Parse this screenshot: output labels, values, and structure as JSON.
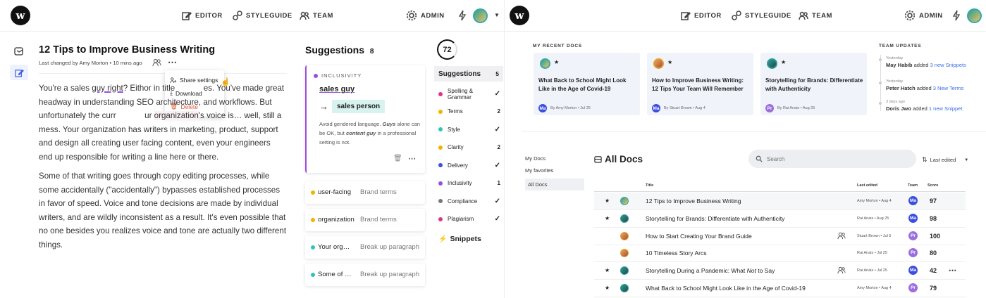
{
  "brand": {
    "logo_letter": "w"
  },
  "nav": {
    "editor": "EDITOR",
    "styleguide": "STYLEGUIDE",
    "team": "TEAM",
    "admin": "ADMIN"
  },
  "editor": {
    "title": "12 Tips to Improve Business Writing",
    "meta_prefix": "Last changed by",
    "meta_author": "Amy Morton",
    "meta_time": "10 mins ago",
    "menu": {
      "share": "Share settings",
      "download": "Download",
      "delete": "Delete"
    },
    "para1_parts": [
      "You're a sales ",
      "guy right",
      "? Eithor in title",
      "es. You've made great headway in understanding SEO",
      "architecture, and workflows. But unfortunately the curr",
      "ur ",
      "organization",
      "'s voice is… well, still a mess. Your organization has writers in marketing, product, support and design all creating user facing content, even your engineers end up responsible for writing a line here or there."
    ],
    "para2": "Some of that writing goes through copy editing processes, while some accidentally (\"accidentally\") bypasses established processes in favor of speed. Voice and tone decisions are made by individual writers, and are wildly inconsistent as a result. It's even possible that no one besides you realizes voice and tone are actually two different things."
  },
  "suggestions_panel": {
    "title": "Suggestions",
    "count": "8",
    "main_card": {
      "category": "INCLUSIVITY",
      "original": "sales guy",
      "replacement": "sales person",
      "explanation_parts": [
        "Avoid gendered language. ",
        "Guys",
        " alone can be OK, but ",
        "content guy",
        " in a professional setting is not."
      ]
    },
    "mini_cards": [
      {
        "term": "user-facing",
        "tag": "Brand terms",
        "color": "#f0b400"
      },
      {
        "term": "organization",
        "tag": "Brand terms",
        "color": "#f0b400"
      },
      {
        "term": "Your org…",
        "tag": "Break up paragraph",
        "color": "#2ec4b6"
      },
      {
        "term": "Some of …",
        "tag": "Break up paragraph",
        "color": "#2ec4b6"
      }
    ]
  },
  "score": "72",
  "categories": {
    "header": "Suggestions",
    "header_count": "5",
    "items": [
      {
        "label": "Spelling & Grammar",
        "value": "✓",
        "color": "#e0338d"
      },
      {
        "label": "Terms",
        "value": "2",
        "color": "#f0b400"
      },
      {
        "label": "Style",
        "value": "✓",
        "color": "#2ec4b6"
      },
      {
        "label": "Clarity",
        "value": "2",
        "color": "#f0b400"
      },
      {
        "label": "Delivery",
        "value": "✓",
        "color": "#3a4ee0"
      },
      {
        "label": "Inclusivity",
        "value": "1",
        "color": "#9b4de0"
      },
      {
        "label": "Compliance",
        "value": "✓",
        "color": "#777777"
      },
      {
        "label": "Plagiarism",
        "value": "✓",
        "color": "#e0338d"
      }
    ],
    "snippets": "Snippets"
  },
  "dashboard": {
    "recent_label": "MY RECENT DOCS",
    "recent": [
      {
        "title": "What Back to School Might Look Like in the Age of Covid-19",
        "initials": "Ma",
        "byline": "By Amy Morton • Jul 25",
        "badge_color": "#3a4ee0"
      },
      {
        "title": "How to Improve Business Writing: 12 Tips Your Team Will Remember",
        "initials": "Ma",
        "byline": "By Stuart Brown • Aug 4",
        "badge_color": "#3a4ee0"
      },
      {
        "title": "Storytelling for Brands: Differentiate with Authenticity",
        "initials": "Pr",
        "byline": "By Rai Anais • Aug 25",
        "badge_color": "#9b6ede"
      }
    ],
    "updates_label": "TEAM UPDATES",
    "updates": [
      {
        "when": "Yesterday",
        "who": "May Habib",
        "action": "added",
        "link": "3 new Snippets"
      },
      {
        "when": "Yesterday",
        "who": "Peter Hatch",
        "action": "added",
        "link": "3 New Terms"
      },
      {
        "when": "3 days ago",
        "who": "Doris Jwo",
        "action": "added",
        "link": "1 new Snippet"
      }
    ],
    "sidebar": [
      "My Docs",
      "My favorites",
      "All Docs"
    ],
    "all_docs_title": "All Docs",
    "search_placeholder": "Search",
    "sort": "Last edited",
    "columns": {
      "title": "Title",
      "last_edited": "Last edited",
      "team": "Team",
      "score": "Score"
    },
    "rows": [
      {
        "star": "★",
        "title": "12 Tips to Improve Business Writing",
        "edited": "Amy Morton • Aug 4",
        "team": "Ma",
        "team_color": "#3a4ee0",
        "score": "97",
        "shared": false
      },
      {
        "star": "★",
        "title": "Storytelling for Brands: Differentiate with Authenticity",
        "edited": "Rai Anais • Aug 25",
        "team": "Ma",
        "team_color": "#3a4ee0",
        "score": "98",
        "shared": false
      },
      {
        "star": "",
        "title": "How to Start Creating Your Brand Guide",
        "edited": "Stuart Brown • Jul 5",
        "team": "Pr",
        "team_color": "#9b6ede",
        "score": "100",
        "shared": true
      },
      {
        "star": "",
        "title": "10 Timeless Story Arcs",
        "edited": "Rai Anais • Jul 25",
        "team": "Pr",
        "team_color": "#9b6ede",
        "score": "80",
        "shared": false
      },
      {
        "star": "★",
        "title_parts": [
          "Storytelling During a Pandemic: What ",
          "Not",
          " to Say"
        ],
        "title": "Storytelling During a Pandemic: What Not to Say",
        "edited": "Rai Anais • Jul 25",
        "team": "Ma",
        "team_color": "#3a4ee0",
        "score": "42",
        "shared": true
      },
      {
        "star": "★",
        "title": "What Back to School Might Look Like in the Age of Covid-19",
        "edited": "Amy Morton • Aug 4",
        "team": "Pr",
        "team_color": "#9b6ede",
        "score": "79",
        "shared": false
      }
    ]
  }
}
